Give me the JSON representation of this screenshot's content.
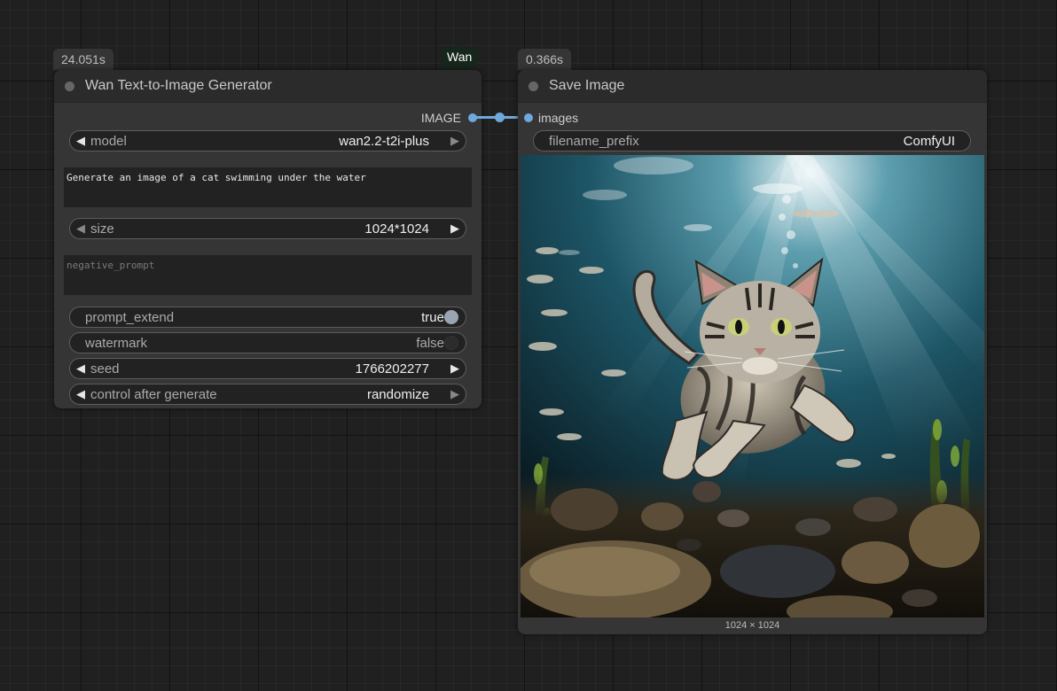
{
  "nodes": {
    "wan": {
      "time": "24.051s",
      "tag": "Wan",
      "title": "Wan Text-to-Image Generator",
      "output_label": "IMAGE",
      "model": {
        "label": "model",
        "value": "wan2.2-t2i-plus"
      },
      "prompt": "Generate an image of a cat swimming under the water",
      "size": {
        "label": "size",
        "value": "1024*1024"
      },
      "negative_prompt_placeholder": "negative_prompt",
      "prompt_extend": {
        "label": "prompt_extend",
        "value": "true"
      },
      "watermark": {
        "label": "watermark",
        "value": "false"
      },
      "seed": {
        "label": "seed",
        "value": "1766202277"
      },
      "control_after_generate": {
        "label": "control after generate",
        "value": "randomize"
      }
    },
    "save": {
      "time": "0.366s",
      "title": "Save Image",
      "input_label": "images",
      "filename_prefix": {
        "label": "filename_prefix",
        "value": "ComfyUI"
      },
      "image_dims": "1024 × 1024"
    }
  },
  "icons": {
    "arrow_left": "◀",
    "arrow_right": "▶"
  },
  "colors": {
    "link": "#6fa8dc",
    "node_bg": "#353535",
    "canvas_bg": "#202020"
  }
}
